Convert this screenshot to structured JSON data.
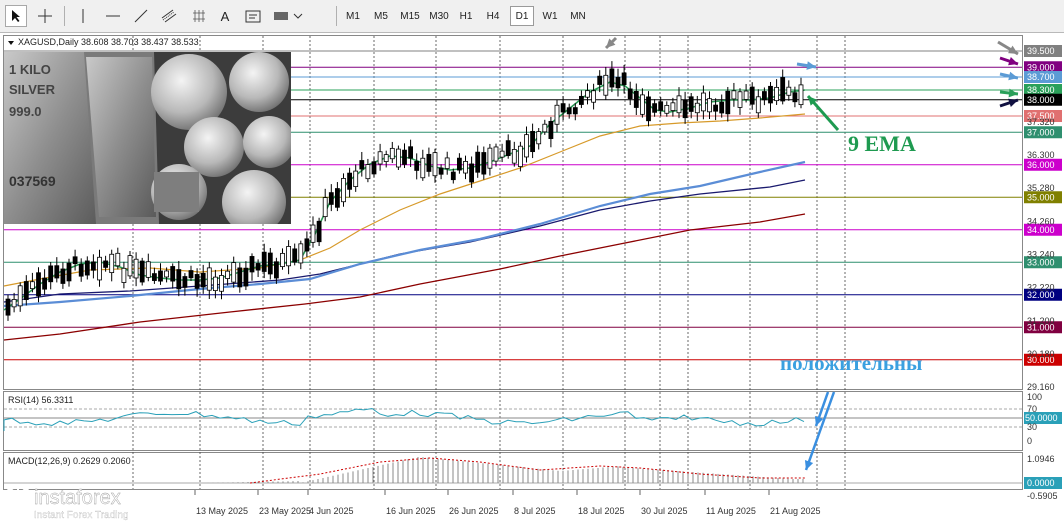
{
  "toolbar": {
    "tools": [
      "cursor-icon",
      "crosshair-icon",
      "vertical-line-icon",
      "horizontal-line-icon",
      "trendline-icon",
      "channel-icon",
      "text-tool-icon",
      "label-tool-icon",
      "shapes-dropdown-icon"
    ],
    "text_tool_label": "A",
    "timeframes": [
      "M1",
      "M5",
      "M15",
      "M30",
      "H1",
      "H4",
      "D1",
      "W1",
      "MN"
    ],
    "selected_timeframe": "D1"
  },
  "chart": {
    "header": "XAGUSD,Daily  38.608 38.703 38.437 38.533",
    "annotation_ema": "9 EMA",
    "annotation_positive": "положительны",
    "price_levels": [
      {
        "label": "39.500",
        "color": "#808080",
        "text_dark": false
      },
      {
        "label": "39.000",
        "color": "#800080",
        "text_dark": false
      },
      {
        "label": "38.700",
        "color": "#5b9bd5",
        "text_dark": false
      },
      {
        "label": "38.300",
        "color": "#2aa05a",
        "text_dark": false
      },
      {
        "label": "38.000",
        "color": "#000000",
        "text_dark": false
      },
      {
        "label": "37.500",
        "color": "#e07070",
        "text_dark": false
      },
      {
        "label": "37.000",
        "color": "#2f8f6f",
        "text_dark": false
      },
      {
        "label": "36.000",
        "color": "#cc00cc",
        "text_dark": false
      },
      {
        "label": "35.000",
        "color": "#808000",
        "text_dark": false
      },
      {
        "label": "34.000",
        "color": "#cc00cc",
        "text_dark": false
      },
      {
        "label": "33.000",
        "color": "#2f8f6f",
        "text_dark": false
      },
      {
        "label": "32.000",
        "color": "#000080",
        "text_dark": false
      },
      {
        "label": "31.000",
        "color": "#800040",
        "text_dark": false
      },
      {
        "label": "30.000",
        "color": "#cc0000",
        "text_dark": false
      }
    ],
    "axis_ticks": [
      "37.320",
      "36.300",
      "35.280",
      "34.260",
      "33.240",
      "32.220",
      "31.200",
      "30.180",
      "29.160"
    ],
    "dates": [
      "13 May 2025",
      "23 May 2025",
      "4 Jun 2025",
      "16 Jun 2025",
      "26 Jun 2025",
      "8 Jul 2025",
      "18 Jul 2025",
      "30 Jul 2025",
      "11 Aug 2025",
      "21 Aug 2025"
    ],
    "rsi": {
      "label": "RSI(14) 56.3311",
      "ticks": [
        "100",
        "70",
        "50.0000",
        "30",
        "0"
      ]
    },
    "macd": {
      "label": "MACD(12,26,9) 0.2629 0.2060",
      "ticks": [
        "1.0946",
        "0.0000",
        "-0.5905"
      ]
    }
  },
  "branding": {
    "logo_text": "instaforex",
    "tagline": "Instant Forex Trading"
  }
}
